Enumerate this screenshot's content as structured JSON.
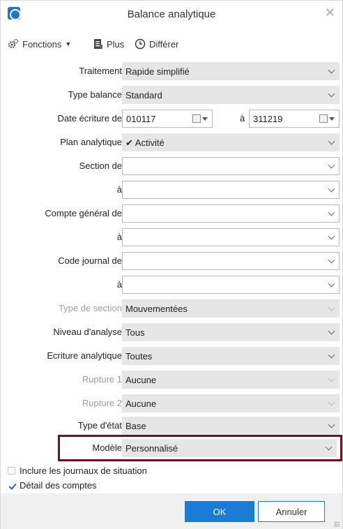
{
  "window": {
    "title": "Balance analytique"
  },
  "toolbar": {
    "fonctions_label": "Fonctions",
    "plus_label": "Plus",
    "differer_label": "Différer"
  },
  "form": {
    "traitement": {
      "label": "Traitement",
      "value": "Rapide simplifié"
    },
    "type_balance": {
      "label": "Type balance",
      "value": "Standard"
    },
    "date_ecriture": {
      "label": "Date écriture de",
      "from": "010117",
      "to_label": "à",
      "to": "311219"
    },
    "plan_analytique": {
      "label": "Plan analytique",
      "value": "✔ Activité"
    },
    "section_de": {
      "label": "Section de",
      "value": ""
    },
    "section_a": {
      "label": "à",
      "value": ""
    },
    "compte_general_de": {
      "label": "Compte général de",
      "value": ""
    },
    "compte_general_a": {
      "label": "à",
      "value": ""
    },
    "code_journal_de": {
      "label": "Code journal de",
      "value": ""
    },
    "code_journal_a": {
      "label": "à",
      "value": ""
    },
    "type_section": {
      "label": "Type de section",
      "value": "Mouvementées",
      "disabled": true
    },
    "niveau_analyse": {
      "label": "Niveau d'analyse",
      "value": "Tous"
    },
    "ecriture_analytique": {
      "label": "Ecriture analytique",
      "value": "Toutes"
    },
    "rupture1": {
      "label": "Rupture 1",
      "value": "Aucune",
      "disabled": true
    },
    "rupture2": {
      "label": "Rupture 2",
      "value": "Aucune",
      "disabled": true
    },
    "type_etat": {
      "label": "Type d'état",
      "value": "Base"
    },
    "modele": {
      "label": "Modèle",
      "value": "Personnalisé"
    }
  },
  "options": {
    "inclure_journaux": {
      "label": "Inclure les journaux de situation",
      "checked": false
    },
    "detail_comptes": {
      "label": "Détail des comptes",
      "checked": true
    }
  },
  "footer": {
    "ok_label": "OK",
    "cancel_label": "Annuler"
  },
  "colors": {
    "accent": "#1c7bd4",
    "highlight_border": "#6e1224"
  }
}
